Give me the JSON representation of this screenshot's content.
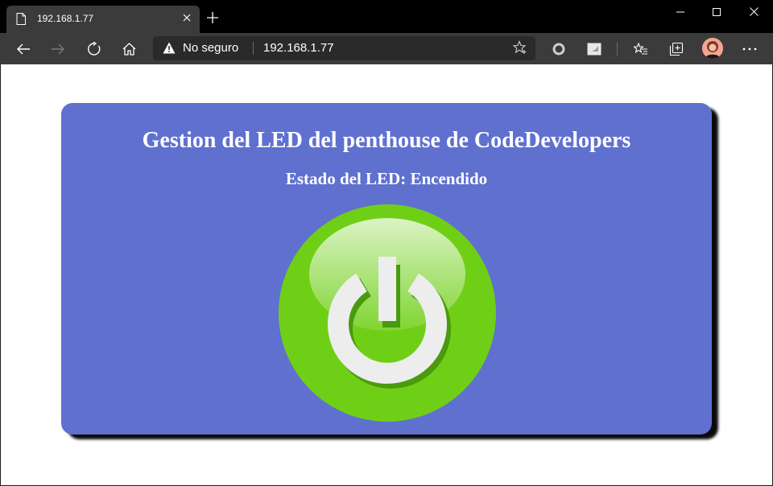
{
  "browser": {
    "tab": {
      "title": "192.168.1.77"
    },
    "address": {
      "security_label": "No seguro",
      "url": "192.168.1.77"
    },
    "icons": [
      "page-icon",
      "close-icon",
      "plus-icon",
      "minimize-icon",
      "maximize-icon",
      "window-close-icon",
      "back-icon",
      "forward-icon",
      "refresh-icon",
      "home-icon",
      "warning-icon",
      "favorite-star-icon",
      "extension-circle-icon",
      "extension-app-icon",
      "favorites-icon",
      "collections-icon",
      "profile-avatar",
      "more-icon"
    ]
  },
  "page": {
    "title": "Gestion del LED del penthouse de CodeDevelopers",
    "status": "Estado del LED: Encendido",
    "power_button": {
      "icon": "power-icon",
      "color": "#6fcf17",
      "state": "on"
    },
    "card_color": "#5f70cf"
  }
}
